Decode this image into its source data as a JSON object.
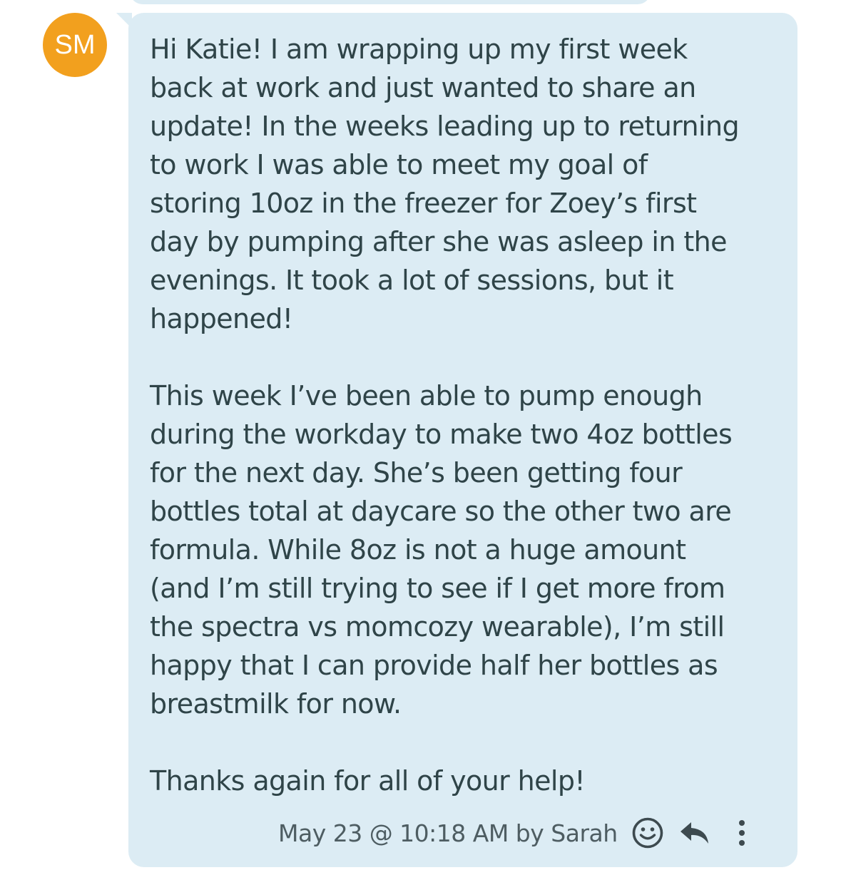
{
  "sender": {
    "initials": "SM",
    "avatar_color": "#f2a01e"
  },
  "message": {
    "paragraphs": [
      "Hi Katie! I am wrapping up my first week\nback at work and just wanted to share an\nupdate! In the weeks leading up to returning\nto work I was able to meet my goal of\nstoring 10oz in the freezer for Zoey’s first\nday by pumping after she was asleep in the\nevenings. It took a lot of sessions, but it\nhappened!",
      "This week I’ve been able to pump enough\nduring the workday to make two 4oz bottles\nfor the next day. She’s been getting four\nbottles total at daycare so the other two are\nformula. While 8oz is not a huge amount\n(and I’m still trying to see if I get more from\nthe spectra vs momcozy wearable), I’m still\nhappy that I can provide half her bottles as\nbreastmilk for now.",
      "Thanks again for all of your help!"
    ],
    "bubble_color": "#dcecf4",
    "text_color": "#2f4448"
  },
  "meta": {
    "timestamp": "May 23 @ 10:18 AM by Sarah",
    "icons": [
      "emoji-reaction-icon",
      "reply-icon",
      "more-options-icon"
    ]
  }
}
